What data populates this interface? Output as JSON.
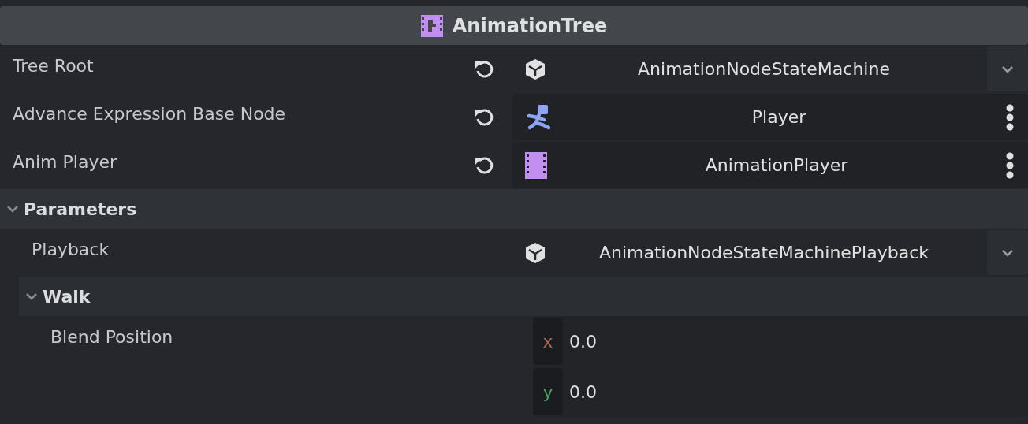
{
  "header": {
    "title": "AnimationTree"
  },
  "properties": [
    {
      "label": "Tree Root",
      "revertable": true,
      "kind": "resource",
      "value": "AnimationNodeStateMachine"
    },
    {
      "label": "Advance Expression Base Node",
      "revertable": true,
      "kind": "character_node",
      "value": "Player"
    },
    {
      "label": "Anim Player",
      "revertable": true,
      "kind": "film_node",
      "value": "AnimationPlayer"
    }
  ],
  "sections": [
    {
      "title": "Parameters",
      "expanded": true,
      "properties": [
        {
          "label": "Playback",
          "revertable": false,
          "kind": "resource",
          "value": "AnimationNodeStateMachinePlayback"
        }
      ],
      "sections": [
        {
          "title": "Walk",
          "expanded": true,
          "properties": [
            {
              "label": "Blend Position",
              "revertable": false,
              "kind": "vector2",
              "components": [
                {
                  "axis": "x",
                  "color": "#a36a52",
                  "value": "0.0"
                },
                {
                  "axis": "y",
                  "color": "#4d9e62",
                  "value": "0.0"
                }
              ]
            }
          ]
        }
      ]
    }
  ]
}
